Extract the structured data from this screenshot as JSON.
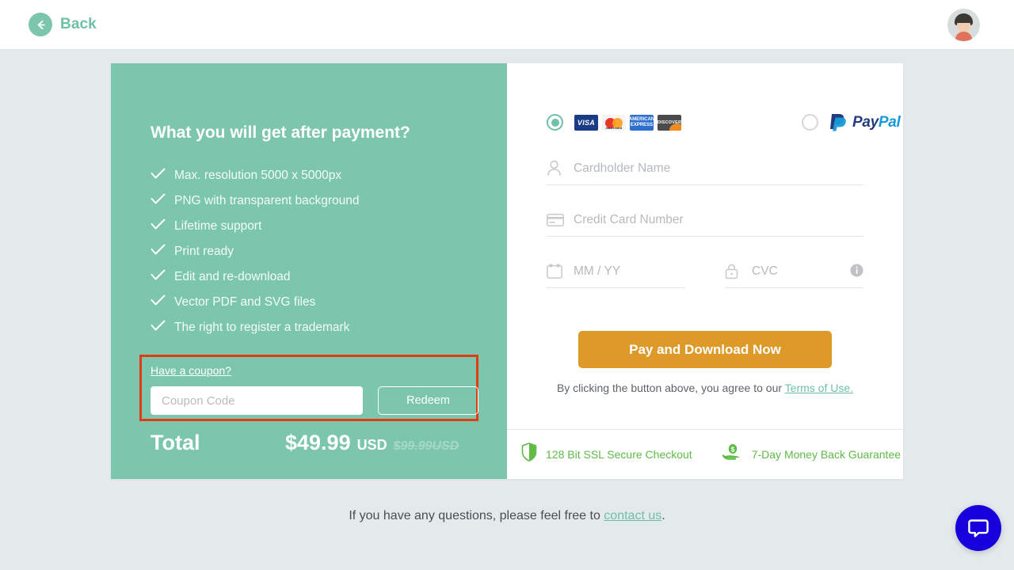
{
  "header": {
    "back_label": "Back",
    "avatar_name": "user-avatar"
  },
  "offer": {
    "title": "What you will get after payment?",
    "features": [
      "Max. resolution 5000 x 5000px",
      "PNG with transparent background",
      "Lifetime support",
      "Print ready",
      "Edit and re-download",
      "Vector PDF and SVG files",
      "The right to register a trademark"
    ],
    "coupon": {
      "link_label": "Have a coupon?",
      "input_value": "",
      "input_placeholder": "Coupon Code",
      "redeem_label": "Redeem",
      "highlight_color": "#e23b11"
    },
    "total": {
      "label": "Total",
      "price": "$49.99",
      "currency": "USD",
      "old_price": "$99.99USD"
    },
    "panel_color": "#7cc6ad"
  },
  "payment": {
    "methods": [
      {
        "id": "card",
        "selected": true,
        "logos": [
          "VISA",
          "mastercard",
          "AMERICAN EXPRESS",
          "DISCOVER"
        ]
      },
      {
        "id": "paypal",
        "selected": false,
        "brand_pay": "Pay",
        "brand_pal": "Pal"
      }
    ],
    "fields": {
      "cardholder": {
        "value": "",
        "placeholder": "Cardholder Name"
      },
      "number": {
        "value": "",
        "placeholder": "Credit Card Number"
      },
      "expiry": {
        "value": "",
        "placeholder": "MM / YY"
      },
      "cvc": {
        "value": "",
        "placeholder": "CVC"
      }
    },
    "submit_label": "Pay and Download Now",
    "submit_color": "#dd9a28",
    "terms_prefix": "By clicking the button above, you agree to our ",
    "terms_link": "Terms of Use.",
    "badges": [
      {
        "text": "128 Bit SSL Secure Checkout",
        "icon": "shield-icon"
      },
      {
        "text": "7-Day Money Back Guarantee",
        "icon": "money-back-icon"
      }
    ],
    "badge_color": "#5dbb46"
  },
  "footer": {
    "text_prefix": "If you have any questions, please feel free to ",
    "link": "contact us",
    "text_suffix": "."
  },
  "chat": {
    "widget_color": "#1800dd"
  }
}
